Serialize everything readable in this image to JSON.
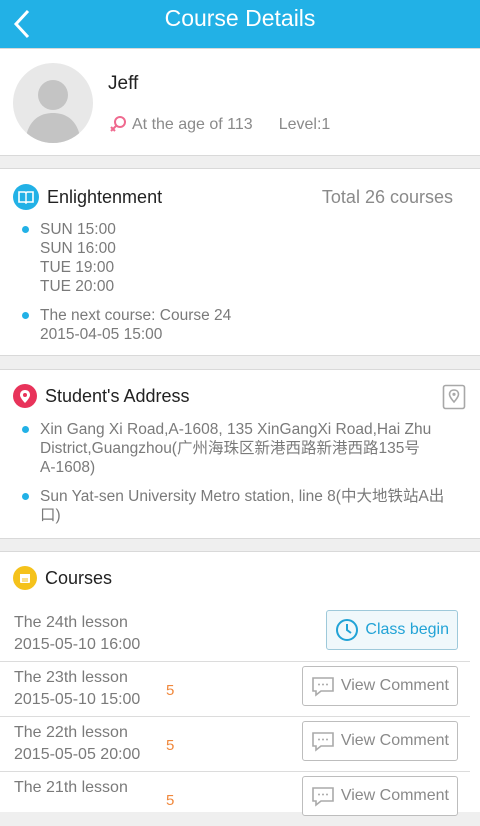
{
  "header": {
    "title": "Course Details"
  },
  "profile": {
    "name": "Jeff",
    "age_text": "At the age of 113",
    "level_text": "Level:1"
  },
  "enlightenment": {
    "title": "Enlightenment",
    "total": "Total 26 courses",
    "schedule": "SUN  15:00\nSUN  16:00\nTUE  19:00\nTUE  20:00",
    "next_course": "The next course: Course 24\n2015-04-05 15:00"
  },
  "address": {
    "title": "Student's Address",
    "line1": "Xin Gang Xi Road,A-1608, 135 XinGangXi Road,Hai Zhu\nDistrict,Guangzhou(广州海珠区新港西路新港西路135号\nA-1608)",
    "line2": "Sun Yat-sen University Metro station, line 8(中大地铁站A出\n口)"
  },
  "courses": {
    "title": "Courses",
    "items": [
      {
        "lesson": "The 24th lesson",
        "datetime": "2015-05-10 16:00",
        "count": "",
        "action": "Class begin"
      },
      {
        "lesson": "The 23th lesson",
        "datetime": "2015-05-10 15:00",
        "count": "5",
        "action": "View Comment"
      },
      {
        "lesson": "The 22th lesson",
        "datetime": "2015-05-05 20:00",
        "count": "5",
        "action": "View Comment"
      },
      {
        "lesson": "The 21th lesson",
        "datetime": "",
        "count": "5",
        "action": "View Comment"
      }
    ]
  },
  "colors": {
    "accent": "#22b1e6",
    "location": "#e8335a",
    "courses": "#f5c21b",
    "count": "#f0883c"
  }
}
